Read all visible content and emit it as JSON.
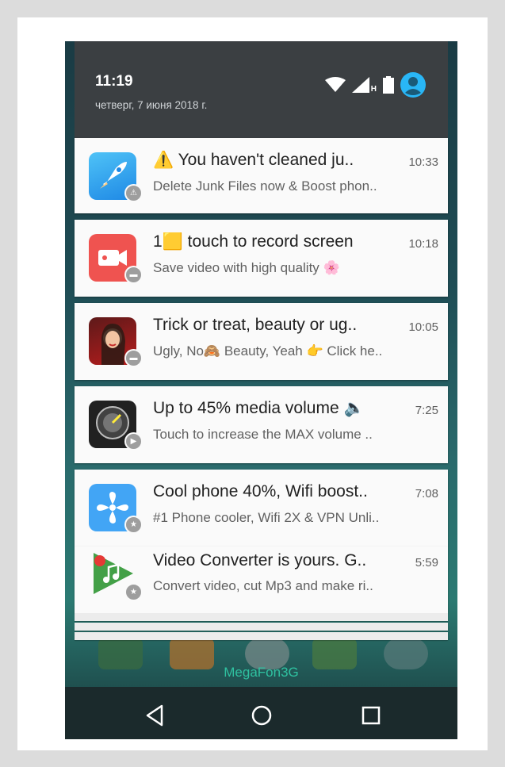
{
  "status_bar": {
    "time": "11:19",
    "date": "четверг, 7 июня 2018 г.",
    "network_label": "H",
    "icons": [
      "wifi-icon",
      "cell-signal-icon",
      "battery-icon",
      "account-icon"
    ]
  },
  "notifications": [
    {
      "title": "⚠️ You haven't cleaned ju..",
      "time": "10:33",
      "text": "Delete Junk Files now & Boost phon..",
      "icon": "rocket-cleaner-icon",
      "badge": "⚠"
    },
    {
      "title": "1🟨 touch to record screen",
      "time": "10:18",
      "text": "Save video with high quality 🌸",
      "icon": "screen-recorder-icon",
      "badge": "▬"
    },
    {
      "title": "Trick or treat, beauty or ug..",
      "time": "10:05",
      "text": "Ugly, No🙈 Beauty, Yeah 👉 Click he..",
      "icon": "beauty-app-icon",
      "badge": "▬"
    },
    {
      "title": "Up to 45% media volume 🔈",
      "time": "7:25",
      "text": "Touch to increase the MAX volume ..",
      "icon": "volume-booster-icon",
      "badge": "▶"
    },
    {
      "title": "Cool phone 40%, Wifi boost..",
      "time": "7:08",
      "text": "#1 Phone cooler, Wifi 2X & VPN Unli..",
      "icon": "phone-cooler-icon",
      "badge": "★"
    },
    {
      "title": "Video Converter is yours. G..",
      "time": "5:59",
      "text": "Convert video, cut Mp3 and make ri..",
      "icon": "video-converter-icon",
      "badge": "★"
    }
  ],
  "carrier": "MegaFon3G",
  "nav": {
    "back": "back-icon",
    "home": "home-icon",
    "recents": "recents-icon"
  },
  "colors": {
    "shade": "#3b3f42",
    "card": "#fafafa",
    "accent": "#29b6f6"
  }
}
